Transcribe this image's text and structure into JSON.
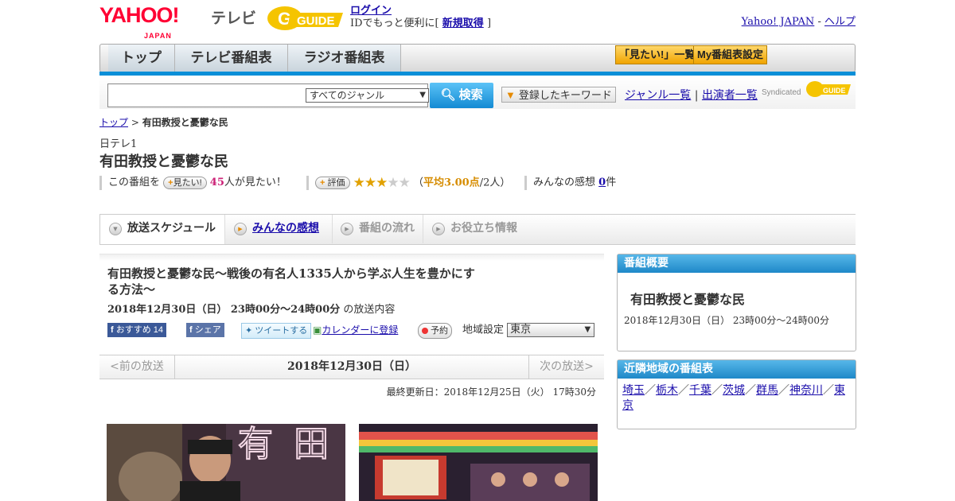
{
  "header": {
    "logo_text": "YAHOO!",
    "logo_sub": "JAPAN",
    "service_name": "テレビ",
    "gguide_logo_text": "GUIDE",
    "login_label": "ログイン",
    "login_message": "IDでもっと便利に[",
    "register_label": "新規取得",
    "register_suffix": "]",
    "yahoo_japan_link": "Yahoo! JAPAN",
    "separator": "-",
    "help_link": "ヘルプ"
  },
  "nav": {
    "tabs": [
      {
        "label": "トップ"
      },
      {
        "label": "テレビ番組表"
      },
      {
        "label": "ラジオ番組表"
      }
    ],
    "watchlist_button": "「見たい!」一覧",
    "my_schedule_button": "My番組表設定"
  },
  "search": {
    "input_value": "",
    "genre_selected": "すべてのジャンル",
    "search_button": "検索",
    "keyword_button": "登録したキーワード",
    "genre_list_link": "ジャンル一覧",
    "divider": "|",
    "cast_list_link": "出演者一覧",
    "syndicated_label": "Syndicated"
  },
  "breadcrumb": {
    "home": "トップ",
    "separator": ">",
    "current": "有田教授と憂鬱な民"
  },
  "program": {
    "channel": "日テレ1",
    "title": "有田教授と憂鬱な民",
    "want_prefix": "この番組を",
    "want_button": "見たい!",
    "want_count": "45",
    "want_suffix": "人が見たい！",
    "rate_button": "評価",
    "rating": 3,
    "rating_max": 5,
    "rating_open": "（",
    "rating_avg_label": "平均3.00点",
    "rating_count": "/2人）",
    "comments_label": "みんなの感想",
    "comments_count": "0",
    "comments_unit": "件"
  },
  "tabs": [
    {
      "label": "放送スケジュール",
      "state": "active"
    },
    {
      "label": "みんなの感想",
      "state": "link"
    },
    {
      "label": "番組の流れ",
      "state": "disabled"
    },
    {
      "label": "お役立ち情報",
      "state": "disabled"
    }
  ],
  "broadcast": {
    "full_title": "有田教授と憂鬱な民～戦後の有名人1335人から学ぶ人生を豊かにする方法～",
    "datetime": "2018年12月30日（日） 23時00分～24時00分",
    "datetime_suffix": "の放送内容",
    "fb_recommend_label": "おすすめ",
    "fb_recommend_count": "14",
    "fb_share_label": "シェア",
    "tweet_label": "ツイートする",
    "calendar_label": "カレンダーに登録",
    "reserve_label": "予約",
    "region_label": "地域設定",
    "region_value": "東京"
  },
  "pager": {
    "prev": "<前の放送",
    "current": "2018年12月30日（日）",
    "next": "次の放送>"
  },
  "updated": "最終更新日：2018年12月25日（火） 17時30分",
  "sidebar": {
    "overview_header": "番組概要",
    "overview_title": "有田教授と憂鬱な民",
    "overview_datetime": "2018年12月30日（日） 23時00分～24時00分",
    "nearby_header": "近隣地域の番組表",
    "areas": [
      "埼玉",
      "栃木",
      "千葉",
      "茨城",
      "群馬",
      "神奈川",
      "東京"
    ],
    "area_separator": "／"
  },
  "colors": {
    "accent_blue": "#0a8fd8",
    "yahoo_red": "#ff0033",
    "star": "#e1a100",
    "link": "#1a0dab"
  }
}
